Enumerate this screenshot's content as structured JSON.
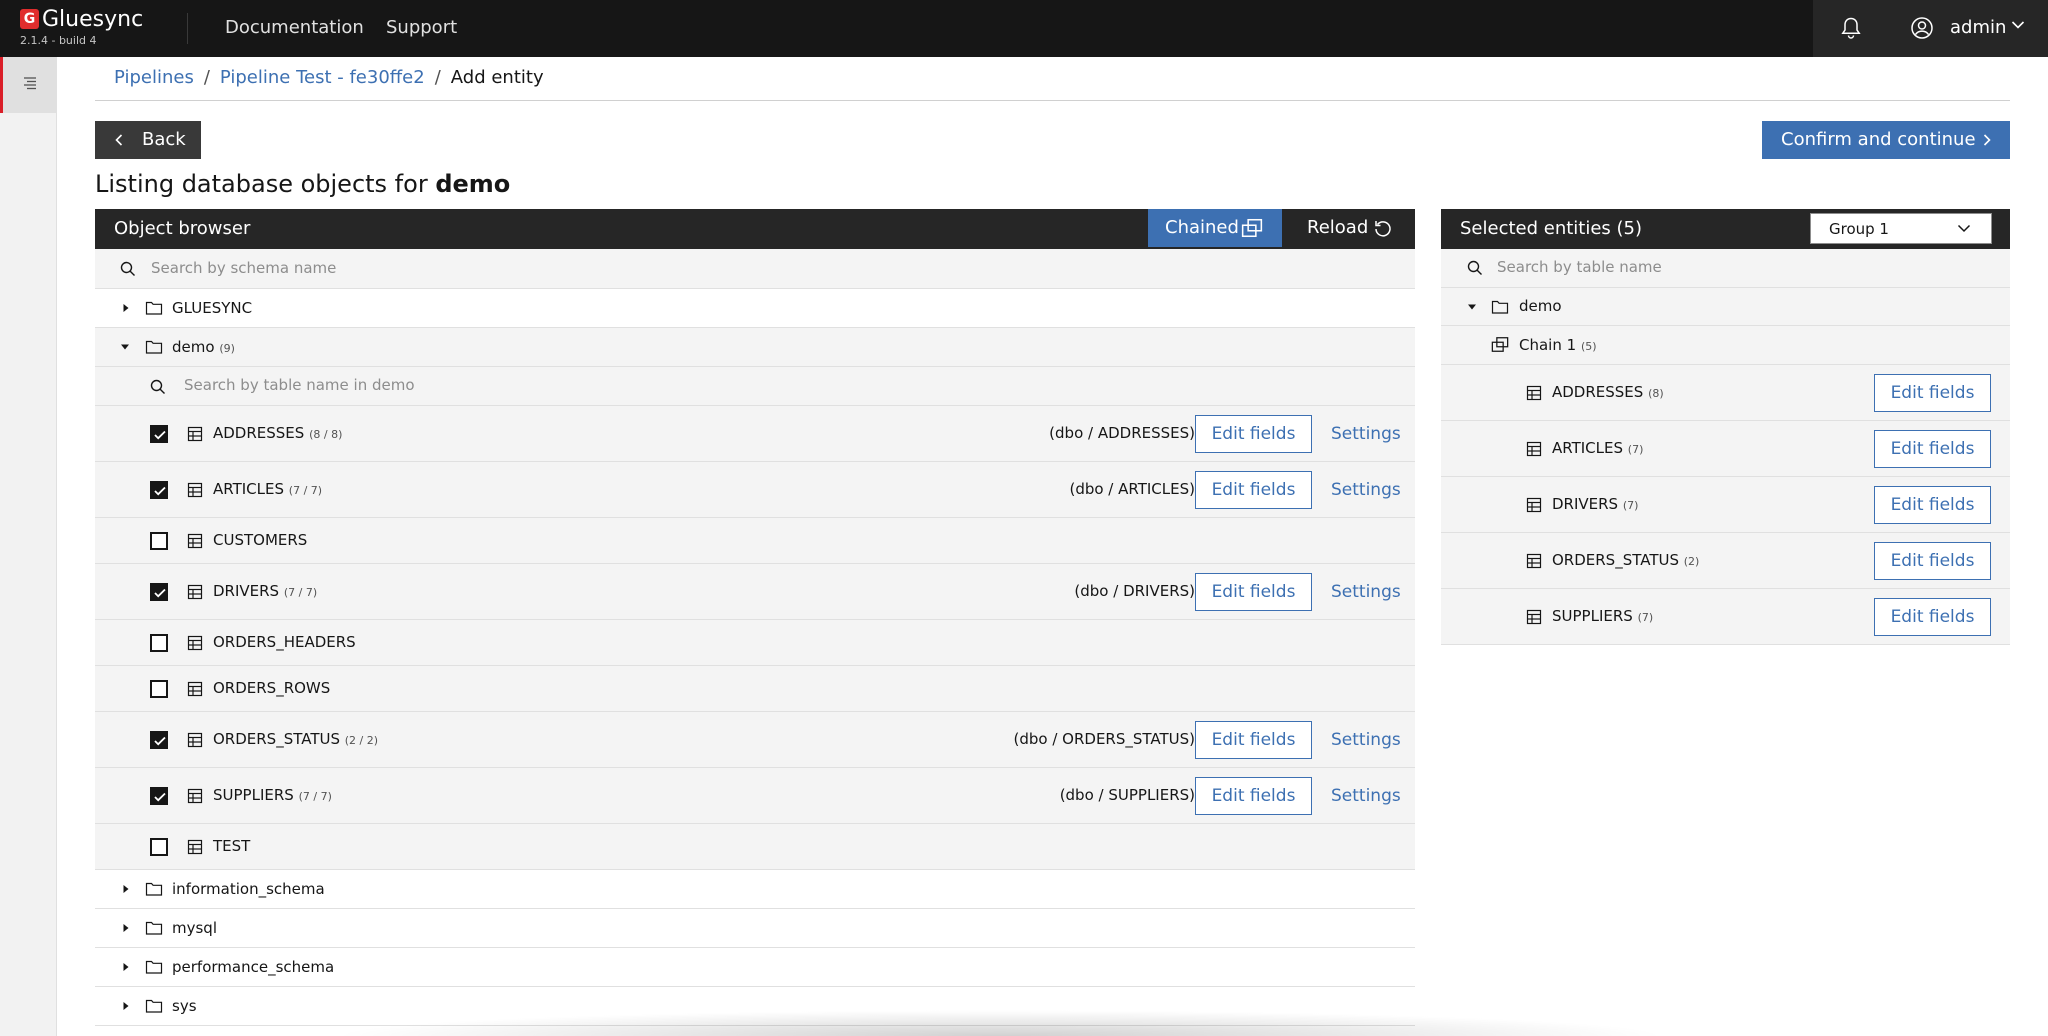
{
  "app": {
    "name": "Gluesync",
    "version": "2.1.4 - build 4"
  },
  "topnav": {
    "documentation": "Documentation",
    "support": "Support",
    "user": "admin"
  },
  "breadcrumb": {
    "pipelines": "Pipelines",
    "pipeline": "Pipeline Test - fe30ffe2",
    "current": "Add entity",
    "sep": "/"
  },
  "actions": {
    "back": "Back",
    "confirm": "Confirm and continue"
  },
  "title": {
    "prefix": "Listing database objects for ",
    "db": "demo"
  },
  "browser": {
    "title": "Object browser",
    "chained": "Chained",
    "reload": "Reload",
    "schema_search_placeholder": "Search by schema name",
    "table_search_placeholder": "Search by table name in demo",
    "schemas": {
      "gluesync": "GLUESYNC",
      "demo": "demo",
      "demo_count": "(9)",
      "information_schema": "information_schema",
      "mysql": "mysql",
      "performance_schema": "performance_schema",
      "sys": "sys"
    },
    "tables": [
      {
        "name": "ADDRESSES",
        "count": "(8 / 8)",
        "checked": true,
        "path": "(dbo / ADDRESSES)"
      },
      {
        "name": "ARTICLES",
        "count": "(7 / 7)",
        "checked": true,
        "path": "(dbo / ARTICLES)"
      },
      {
        "name": "CUSTOMERS",
        "count": "",
        "checked": false,
        "path": ""
      },
      {
        "name": "DRIVERS",
        "count": "(7 / 7)",
        "checked": true,
        "path": "(dbo / DRIVERS)"
      },
      {
        "name": "ORDERS_HEADERS",
        "count": "",
        "checked": false,
        "path": ""
      },
      {
        "name": "ORDERS_ROWS",
        "count": "",
        "checked": false,
        "path": ""
      },
      {
        "name": "ORDERS_STATUS",
        "count": "(2 / 2)",
        "checked": true,
        "path": "(dbo / ORDERS_STATUS)"
      },
      {
        "name": "SUPPLIERS",
        "count": "(7 / 7)",
        "checked": true,
        "path": "(dbo / SUPPLIERS)"
      },
      {
        "name": "TEST",
        "count": "",
        "checked": false,
        "path": ""
      }
    ],
    "edit_fields": "Edit fields",
    "settings": "Settings"
  },
  "selected": {
    "title": "Selected entities (5)",
    "group": "Group 1",
    "search_placeholder": "Search by table name",
    "schema": "demo",
    "chain": "Chain 1",
    "chain_count": "(5)",
    "entities": [
      {
        "name": "ADDRESSES",
        "count": "(8)"
      },
      {
        "name": "ARTICLES",
        "count": "(7)"
      },
      {
        "name": "DRIVERS",
        "count": "(7)"
      },
      {
        "name": "ORDERS_STATUS",
        "count": "(2)"
      },
      {
        "name": "SUPPLIERS",
        "count": "(7)"
      }
    ],
    "edit_fields": "Edit fields"
  },
  "colors": {
    "accent": "#3d70b2",
    "dark": "#161616",
    "brand_red": "#e02d2d"
  }
}
